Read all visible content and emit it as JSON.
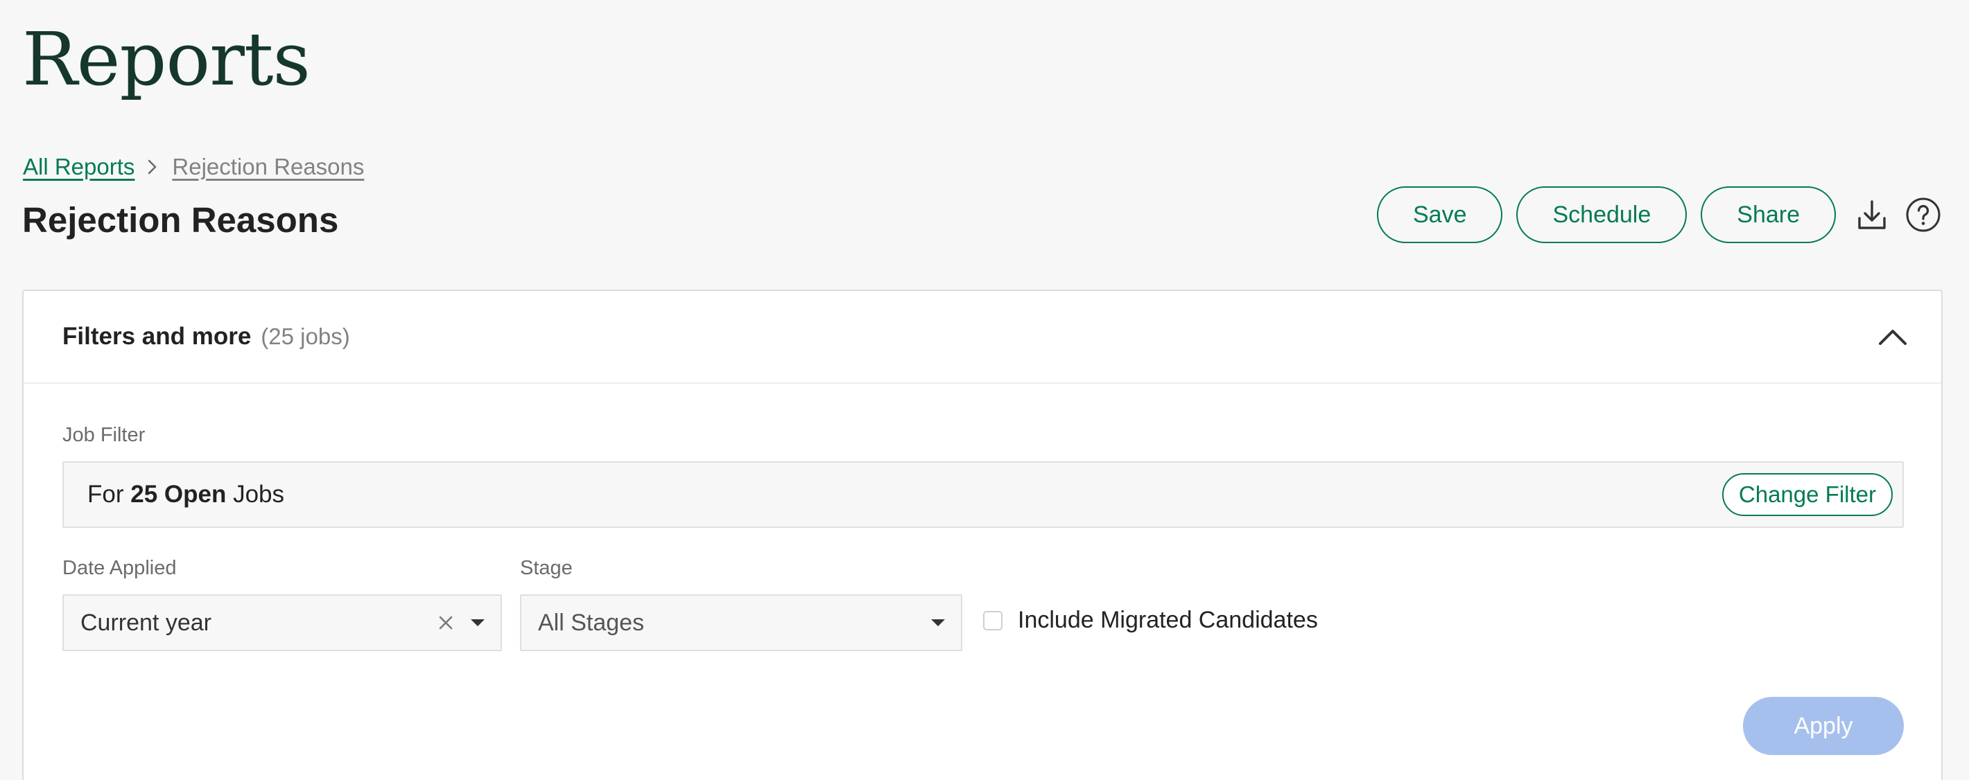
{
  "page": {
    "title": "Reports"
  },
  "breadcrumb": {
    "root_label": "All Reports",
    "current_label": "Rejection Reasons",
    "separator_icon": "chevron-right-icon"
  },
  "report": {
    "title": "Rejection Reasons"
  },
  "actions": {
    "save_label": "Save",
    "schedule_label": "Schedule",
    "share_label": "Share",
    "download_icon": "download-icon",
    "help_icon": "help-circle-icon"
  },
  "filters": {
    "title": "Filters and more",
    "count": "(25 jobs)",
    "collapse_icon": "chevron-up-icon",
    "job_filter": {
      "label": "Job Filter",
      "prefix": "For",
      "emphasis": "25 Open",
      "suffix": "Jobs",
      "change_label": "Change Filter"
    },
    "date_applied": {
      "label": "Date Applied",
      "value": "Current year",
      "clear_icon": "close-icon",
      "caret_icon": "caret-down-icon"
    },
    "stage": {
      "label": "Stage",
      "value": "All Stages",
      "caret_icon": "caret-down-icon"
    },
    "include_migrated": {
      "label": "Include Migrated Candidates",
      "checked": false
    },
    "apply_label": "Apply"
  },
  "colors": {
    "brand_green": "#047a55",
    "title_dark_green": "#15372c",
    "apply_disabled": "#a6c0ee",
    "background": "#f7f7f7"
  }
}
